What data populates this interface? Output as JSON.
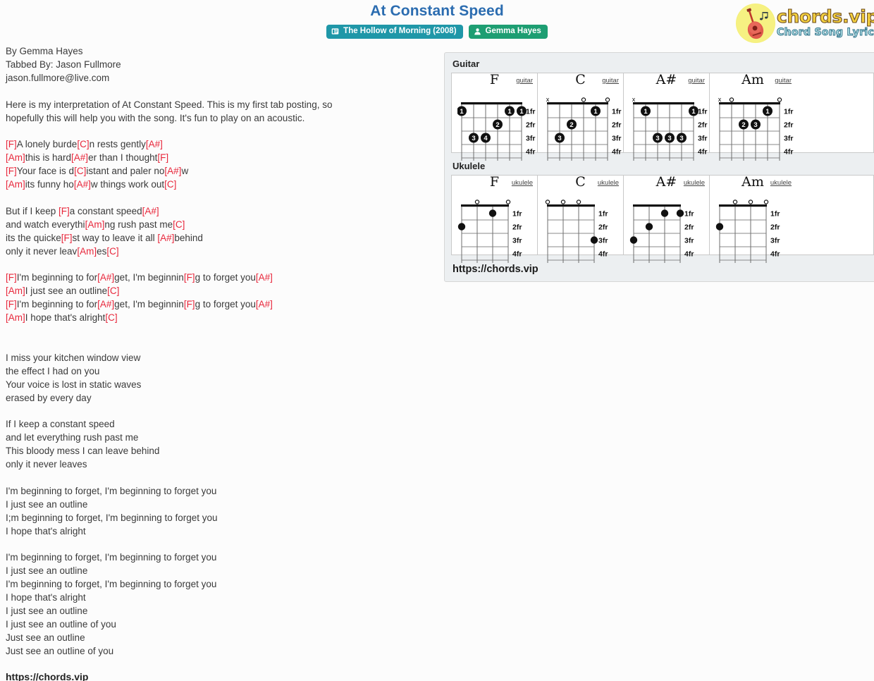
{
  "header": {
    "title": "At Constant Speed",
    "album_badge": {
      "label": "The Hollow of Morning (2008)",
      "icon": "album-icon",
      "color": "#1f97a8"
    },
    "artist_badge": {
      "label": "Gemma Hayes",
      "icon": "person-icon",
      "color": "#1d9e72"
    },
    "logo": {
      "main": "chords.vip",
      "sub": "Chord Song Lyric",
      "icon": "guitar-icon"
    }
  },
  "lyrics": {
    "text": "By Gemma Hayes\nTabbed By: Jason Fullmore\njason.fullmore@live.com\n\nHere is my interpretation of At Constant Speed. This is my first tab posting, so\nhopefully this will help you with the song. It's fun to play on an acoustic.\n\n[F]A lonely burde[C]n rests gently[A#]\n[Am]this is hard[A#]er than I thought[F]\n[F]Your face is d[C]istant and paler no[A#]w\n[Am]its funny ho[A#]w things work out[C]\n\nBut if I keep [F]a constant speed[A#]\nand watch everythi[Am]ng rush past me[C]\nits the quicke[F]st way to leave it all [A#]behind\nonly it never leav[Am]es[C]\n\n[F]I'm beginning to for[A#]get, I'm beginnin[F]g to forget you[A#]\n[Am]I just see an outline[C]\n[F]I'm beginning to for[A#]get, I'm beginnin[F]g to forget you[A#]\n[Am]I hope that's alright[C]\n\n\nI miss your kitchen window view\nthe effect I had on you\nYour voice is lost in static waves\nerased by every day\n\nIf I keep a constant speed\nand let everything rush past me\nThis bloody mess I can leave behind\nonly it never leaves\n\nI'm beginning to forget, I'm beginning to forget you\nI just see an outline\nI;m beginning to forget, I'm beginning to forget you\nI hope that's alright\n\nI'm beginning to forget, I'm beginning to forget you\nI just see an outline\nI'm beginning to forget, I'm beginning to forget you\nI hope that's alright\nI just see an outline\nI just see an outline of you\nJust see an outline\nJust see an outline of you",
    "url": "https://chords.vip"
  },
  "chord_panel": {
    "guitar_heading": "Guitar",
    "ukulele_heading": "Ukulele",
    "url": "https://chords.vip",
    "fret_labels": [
      "1fr",
      "2fr",
      "3fr",
      "4fr"
    ],
    "guitar": [
      {
        "name": "F",
        "instrument": "guitar",
        "strings": 6,
        "open_marks": [],
        "muted_marks": [],
        "dots": [
          {
            "string": 6,
            "fret": 1,
            "finger": "1"
          },
          {
            "string": 2,
            "fret": 1,
            "finger": "1"
          },
          {
            "string": 1,
            "fret": 1,
            "finger": "1"
          },
          {
            "string": 3,
            "fret": 2,
            "finger": "2"
          },
          {
            "string": 5,
            "fret": 3,
            "finger": "3"
          },
          {
            "string": 4,
            "fret": 3,
            "finger": "4"
          }
        ]
      },
      {
        "name": "C",
        "instrument": "guitar",
        "strings": 6,
        "open_marks": [
          3,
          1
        ],
        "muted_marks": [
          6
        ],
        "dots": [
          {
            "string": 2,
            "fret": 1,
            "finger": "1"
          },
          {
            "string": 4,
            "fret": 2,
            "finger": "2"
          },
          {
            "string": 5,
            "fret": 3,
            "finger": "3"
          }
        ]
      },
      {
        "name": "A#",
        "instrument": "guitar",
        "strings": 6,
        "open_marks": [],
        "muted_marks": [
          6
        ],
        "dots": [
          {
            "string": 5,
            "fret": 1,
            "finger": "1"
          },
          {
            "string": 1,
            "fret": 1,
            "finger": "1"
          },
          {
            "string": 4,
            "fret": 3,
            "finger": "3"
          },
          {
            "string": 3,
            "fret": 3,
            "finger": "3"
          },
          {
            "string": 2,
            "fret": 3,
            "finger": "3"
          }
        ]
      },
      {
        "name": "Am",
        "instrument": "guitar",
        "strings": 6,
        "open_marks": [
          5,
          1
        ],
        "muted_marks": [
          6
        ],
        "dots": [
          {
            "string": 2,
            "fret": 1,
            "finger": "1"
          },
          {
            "string": 4,
            "fret": 2,
            "finger": "2"
          },
          {
            "string": 3,
            "fret": 2,
            "finger": "3"
          }
        ]
      }
    ],
    "ukulele": [
      {
        "name": "F",
        "instrument": "ukulele",
        "strings": 4,
        "open_marks": [
          3,
          1
        ],
        "muted_marks": [],
        "dots": [
          {
            "string": 2,
            "fret": 1,
            "finger": ""
          },
          {
            "string": 4,
            "fret": 2,
            "finger": ""
          }
        ]
      },
      {
        "name": "C",
        "instrument": "ukulele",
        "strings": 4,
        "open_marks": [
          4,
          3,
          2
        ],
        "muted_marks": [],
        "dots": [
          {
            "string": 1,
            "fret": 3,
            "finger": ""
          }
        ]
      },
      {
        "name": "A#",
        "instrument": "ukulele",
        "strings": 4,
        "open_marks": [],
        "muted_marks": [],
        "dots": [
          {
            "string": 2,
            "fret": 1,
            "finger": ""
          },
          {
            "string": 1,
            "fret": 1,
            "finger": ""
          },
          {
            "string": 3,
            "fret": 2,
            "finger": ""
          },
          {
            "string": 4,
            "fret": 3,
            "finger": ""
          }
        ]
      },
      {
        "name": "Am",
        "instrument": "ukulele",
        "strings": 4,
        "open_marks": [
          3,
          2,
          1
        ],
        "muted_marks": [],
        "dots": [
          {
            "string": 4,
            "fret": 2,
            "finger": ""
          }
        ]
      }
    ]
  }
}
